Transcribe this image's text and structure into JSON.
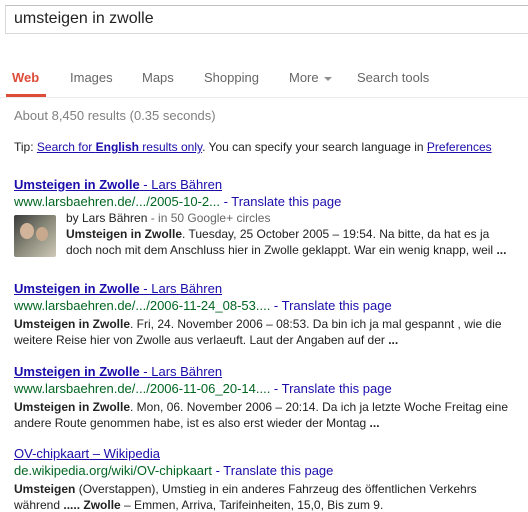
{
  "search": {
    "query": "umsteigen in zwolle"
  },
  "tabs": {
    "web": "Web",
    "images": "Images",
    "maps": "Maps",
    "shopping": "Shopping",
    "more": "More",
    "tools": "Search tools"
  },
  "stats": "About 8,450 results (0.35 seconds)",
  "tip": {
    "prefix": "Tip: ",
    "link_a": "Search for ",
    "link_b": "English",
    "link_c": " results only",
    "middle": ". You can specify your search language in ",
    "prefs": "Preferences"
  },
  "results": [
    {
      "title_hl": "Umsteigen in Zwolle",
      "title_rest": " - Lars Bähren",
      "url": "www.larsbaehren.de/.../2005-10-2...",
      "translate": " - Translate this page",
      "byline_prefix": "by Lars Bähren",
      "byline_suffix": " - in 50 Google+ circles",
      "snippet1_b": "Umsteigen in Zwolle",
      "snippet1_rest": ". Tuesday, 25 October 2005 – 19:54. Na bitte, da hat es ja",
      "snippet2": "doch noch mit dem Anschluss hier in Zwolle geklappt. War ein wenig knapp, weil",
      "snippet2_end": " ..."
    },
    {
      "title_hl": "Umsteigen in Zwolle",
      "title_rest": " - Lars Bähren",
      "url": "www.larsbaehren.de/.../2006-11-24_08-53....",
      "translate": " - Translate this page",
      "snippet1_b": "Umsteigen in Zwolle",
      "snippet1_rest": ". Fri, 24. November 2006 – 08:53. Da bin ich ja mal gespannt , wie die",
      "snippet2": "weitere Reise hier von Zwolle aus verlaeuft. Laut der Angaben auf der",
      "snippet2_end": " ..."
    },
    {
      "title_hl": "Umsteigen in Zwolle",
      "title_rest": " - Lars Bähren",
      "url": "www.larsbaehren.de/.../2006-11-06_20-14....",
      "translate": " - Translate this page",
      "snippet1_b": "Umsteigen in Zwolle",
      "snippet1_rest": ". Mon, 06. November 2006 – 20:14. Da ich ja letzte Woche Freitag eine",
      "snippet2": "andere Route genommen habe, ist es also erst wieder der Montag",
      "snippet2_end": " ..."
    },
    {
      "title_hl": "OV-chipkaart",
      "title_rest": " – Wikipedia",
      "url": "de.wikipedia.org/wiki/OV-chipkaart",
      "translate": " - Translate this page",
      "snippet1_b": "Umsteigen",
      "snippet1_rest": " (Overstappen), Umstieg in ein anderes Fahrzeug des öffentlichen Verkehrs",
      "snippet2_pre": "während ",
      "snippet2_b": "..... Zwolle",
      "snippet2": " – Emmen, Arriva, Tarifeinheiten, 15,0, Bis zum 9."
    }
  ]
}
